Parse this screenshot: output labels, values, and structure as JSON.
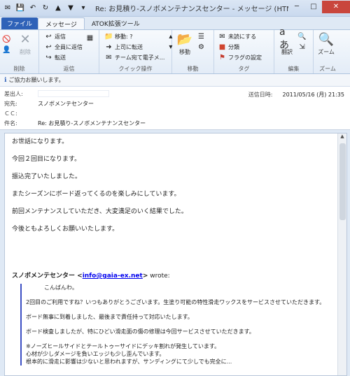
{
  "window": {
    "title": "Re: お見積り-スノボメンテナンスセンター - メッセージ (HTML 形式) (読み取り..."
  },
  "tabs": [
    {
      "label": "ファイル"
    },
    {
      "label": "メッセージ"
    },
    {
      "label": "ATOK拡張ツール"
    }
  ],
  "ribbon": {
    "delete_group": {
      "label": "削除",
      "delete": "削除"
    },
    "reply_group": {
      "label": "返信",
      "reply": "返信",
      "reply_all": "全員に返信",
      "forward": "転送"
    },
    "quick_group": {
      "label": "クイック操作",
      "move_to": "移動: ?",
      "to_manager": "上司に転送",
      "team_email": "チーム宛て電子メ..."
    },
    "move_group": {
      "label": "移動",
      "move": "移動"
    },
    "tags_group": {
      "label": "タグ",
      "mark_unread": "未読にする",
      "categorize": "分類",
      "followup": "フラグの設定"
    },
    "edit_group": {
      "label": "編集",
      "translate": "翻訳"
    },
    "zoom_group": {
      "label": "ズーム",
      "zoom": "ズーム"
    }
  },
  "infobar": {
    "text": "ご協力お願いします。"
  },
  "header": {
    "from_label": "差出人:",
    "to_label": "宛先:",
    "to_value": "スノボメンテセンター",
    "cc_label": "ＣＣ:",
    "subject_label": "件名:",
    "subject_value": "Re: お見積り-スノボメンテナンスセンター",
    "sent_label": "送信日時:",
    "sent_value": "2011/05/16 (月) 21:35"
  },
  "body": {
    "lines": [
      "お世話になります。",
      "今回２回目になります。",
      "振込完了いたしました。",
      "またシーズンにボード返ってくるのを楽しみにしています。",
      "前回メンテナンスしていただき、大変満足のいく結果でした。",
      "今後ともよろしくお願いいたします。"
    ],
    "quote_sender": "スノボメンテセンター <",
    "quote_email": "info@gaia-ex.net",
    "quote_close": ">",
    "quote_wrote": " wrote:",
    "quote_lines": [
      "こんばんわ。",
      "2回目のご利用ですね？いつもありがとうございます。生塗り可能の特性滑走ワックスをサービスさせていただきます。",
      "ボード無事に到着しました、最後まで責任持って対応いたします。",
      "ボード検査しましたが、特にひどい滑走面の傷の修理は今回サービスさせていただきます。",
      "※ノーズヒールサイドとテールトゥーサイドにデッキ割れが発生しています。",
      "心材が少しダメージを負いエッジも少し歪んでいます。",
      "根本的に滑走に影響は少ないと思われますが、サンディングにて少しでも完全に..."
    ]
  }
}
